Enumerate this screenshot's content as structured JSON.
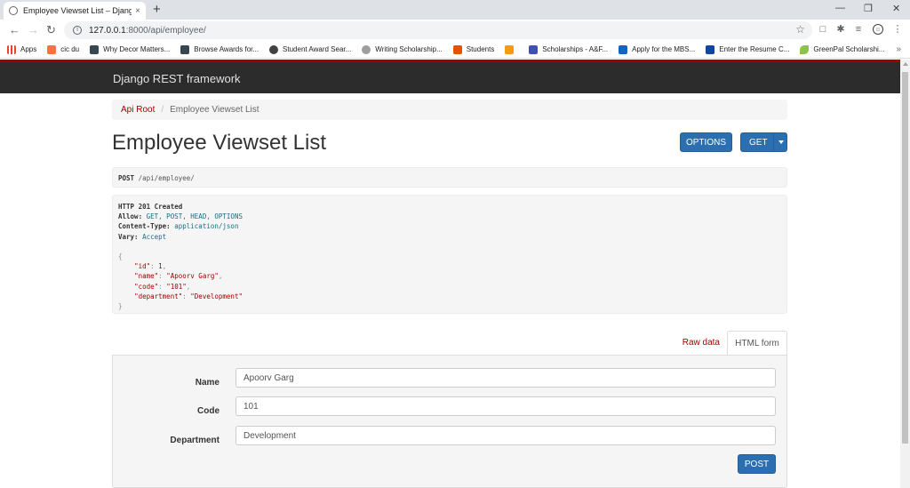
{
  "browser": {
    "tab_title": "Employee Viewset List – Django R",
    "tab_close": "×",
    "new_tab": "+",
    "url_host": "127.0.0.1",
    "url_path": ":8000/api/employee/",
    "bookmarks": [
      {
        "label": "Apps",
        "color": "#ea4335"
      },
      {
        "label": "cic du",
        "color": "#ff7043"
      },
      {
        "label": "Why Decor Matters...",
        "color": "#37474f"
      },
      {
        "label": "Browse Awards for...",
        "color": "#37474f"
      },
      {
        "label": "Student Award Sear...",
        "color": "#424242"
      },
      {
        "label": "Writing Scholarship...",
        "color": "#9e9e9e"
      },
      {
        "label": "Students",
        "color": "#e65100"
      },
      {
        "label": "",
        "color": "#f39c12"
      },
      {
        "label": "Scholarships - A&F...",
        "color": "#3f51b5"
      },
      {
        "label": "Apply for the MBS...",
        "color": "#1565c0"
      },
      {
        "label": "Enter the Resume C...",
        "color": "#0d47a1"
      },
      {
        "label": "GreenPal Scholarshi...",
        "color": "#8bc34a"
      }
    ],
    "bookmarks_more": "»"
  },
  "page": {
    "brand": "Django REST framework",
    "breadcrumb": {
      "root": "Api Root",
      "separator": "/",
      "current": "Employee Viewset List"
    },
    "title": "Employee Viewset List",
    "options_label": "OPTIONS",
    "get_label": "GET",
    "request": {
      "method": "POST",
      "url": "/api/employee/"
    },
    "response": {
      "status": "HTTP 201 Created",
      "headers": [
        {
          "name": "Allow:",
          "value": "GET, POST, HEAD, OPTIONS"
        },
        {
          "name": "Content-Type:",
          "value": "application/json"
        },
        {
          "name": "Vary:",
          "value": "Accept"
        }
      ],
      "body": {
        "open": "{",
        "close": "}",
        "fields": [
          {
            "key": "\"id\"",
            "value": "1",
            "type": "num"
          },
          {
            "key": "\"name\"",
            "value": "\"Apoorv Garg\"",
            "type": "str"
          },
          {
            "key": "\"code\"",
            "value": "\"101\"",
            "type": "str"
          },
          {
            "key": "\"department\"",
            "value": "\"Development\"",
            "type": "str"
          }
        ]
      }
    },
    "tabs": {
      "raw": "Raw data",
      "html": "HTML form"
    },
    "form": {
      "fields": [
        {
          "label": "Name",
          "value": "Apoorv Garg"
        },
        {
          "label": "Code",
          "value": "101"
        },
        {
          "label": "Department",
          "value": "Development"
        }
      ],
      "submit_label": "POST"
    },
    "colors": {
      "nav_bg": "#2c2c2c",
      "accent_red": "#a30000",
      "button_blue": "#2c6fb0"
    }
  }
}
